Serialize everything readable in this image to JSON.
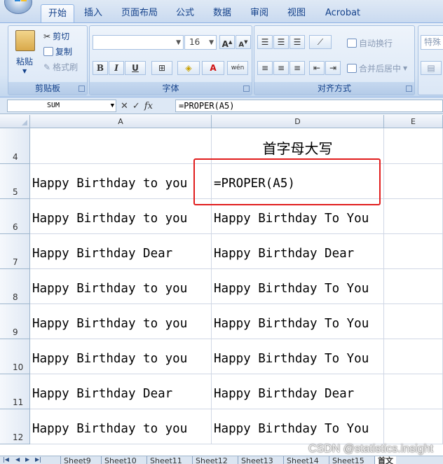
{
  "ribbon_tabs": [
    "开始",
    "插入",
    "页面布局",
    "公式",
    "数据",
    "审阅",
    "视图",
    "Acrobat"
  ],
  "clipboard": {
    "paste": "粘贴",
    "cut": "剪切",
    "copy": "复制",
    "format_painter": "格式刷",
    "label": "剪贴板"
  },
  "font": {
    "name": "",
    "size": "16",
    "bold": "B",
    "italic": "I",
    "underline": "U",
    "label": "字体"
  },
  "alignment": {
    "wrap_text": "自动换行",
    "merge_center": "合并后居中",
    "label": "对齐方式"
  },
  "number": {
    "format": "特殊"
  },
  "formula_bar": {
    "name_box": "SUM",
    "formula": "=PROPER(A5)"
  },
  "columns": [
    "A",
    "D",
    "E"
  ],
  "header_cell": "首字母大写",
  "rows": [
    {
      "num": "4",
      "a": "",
      "d": "首字母大写"
    },
    {
      "num": "5",
      "a": "Happy Birthday to you",
      "d": "=PROPER(A5)"
    },
    {
      "num": "6",
      "a": "Happy Birthday to you",
      "d": "Happy Birthday To You"
    },
    {
      "num": "7",
      "a": "Happy Birthday Dear",
      "d": "Happy Birthday Dear"
    },
    {
      "num": "8",
      "a": "Happy Birthday to you",
      "d": "Happy Birthday To You"
    },
    {
      "num": "9",
      "a": "Happy Birthday to you",
      "d": "Happy Birthday To You"
    },
    {
      "num": "10",
      "a": "Happy Birthday to you",
      "d": "Happy Birthday To You"
    },
    {
      "num": "11",
      "a": "Happy Birthday Dear",
      "d": "Happy Birthday Dear"
    },
    {
      "num": "12",
      "a": "Happy Birthday to you",
      "d": "Happy Birthday To You"
    }
  ],
  "sheet_tabs": [
    "Sheet9",
    "Sheet10",
    "Sheet11",
    "Sheet12",
    "Sheet13",
    "Sheet14",
    "Sheet15",
    "首文"
  ],
  "active_sheet": "首文",
  "watermark": "CSDN @statistics.insight",
  "colors": {
    "highlight_border": "#e11d1d",
    "ribbon_text": "#15428b"
  }
}
